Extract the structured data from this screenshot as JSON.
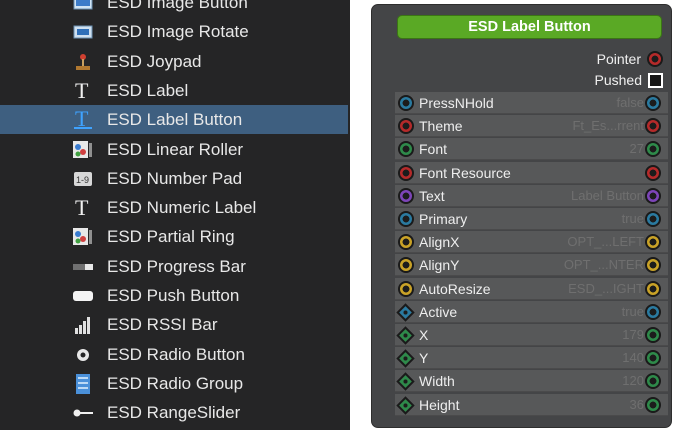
{
  "palette": {
    "items": [
      {
        "label": "ESD Image Button",
        "icon": "image-button-icon"
      },
      {
        "label": "ESD Image Rotate",
        "icon": "image-rotate-icon"
      },
      {
        "label": "ESD Joypad",
        "icon": "joystick-icon"
      },
      {
        "label": "ESD Label",
        "icon": "text-t-icon"
      },
      {
        "label": "ESD Label Button",
        "icon": "text-t-blue-icon"
      },
      {
        "label": "ESD Linear Roller",
        "icon": "linear-roller-icon"
      },
      {
        "label": "ESD Number Pad",
        "icon": "number-pad-icon"
      },
      {
        "label": "ESD Numeric Label",
        "icon": "text-t-icon"
      },
      {
        "label": "ESD Partial Ring",
        "icon": "partial-ring-icon"
      },
      {
        "label": "ESD Progress Bar",
        "icon": "progress-bar-icon"
      },
      {
        "label": "ESD Push Button",
        "icon": "push-button-icon"
      },
      {
        "label": "ESD RSSI Bar",
        "icon": "rssi-bars-icon"
      },
      {
        "label": "ESD Radio Button",
        "icon": "radio-button-icon"
      },
      {
        "label": "ESD Radio Group",
        "icon": "radio-group-icon"
      },
      {
        "label": "ESD RangeSlider",
        "icon": "range-slider-icon"
      }
    ],
    "selected_index": 4
  },
  "node": {
    "title": "ESD Label Button",
    "outputs": [
      {
        "label": "Pointer",
        "port_color": "#b52a2a",
        "shape": "circle"
      },
      {
        "label": "Pushed",
        "port_color": "#ffffff",
        "shape": "square"
      }
    ],
    "properties": [
      {
        "name": "PressNHold",
        "value": "false",
        "in_color": "#2a7aa0",
        "out_color": "#2a7aa0",
        "in_shape": "circle"
      },
      {
        "name": "Theme",
        "value": "Ft_Es...rrent",
        "in_color": "#b52a2a",
        "out_color": "#b52a2a",
        "in_shape": "circle"
      },
      {
        "name": "Font",
        "value": "27",
        "in_color": "#2e8a4a",
        "out_color": "#2e8a4a",
        "in_shape": "circle"
      },
      {
        "name": "Font Resource",
        "value": "",
        "in_color": "#b52a2a",
        "out_color": "#b52a2a",
        "in_shape": "circle"
      },
      {
        "name": "Text",
        "value": "Label Button",
        "in_color": "#7d45b8",
        "out_color": "#7d45b8",
        "in_shape": "circle"
      },
      {
        "name": "Primary",
        "value": "true",
        "in_color": "#2a7aa0",
        "out_color": "#2a7aa0",
        "in_shape": "circle"
      },
      {
        "name": "AlignX",
        "value": "OPT_...LEFT",
        "in_color": "#c9a227",
        "out_color": "#c9a227",
        "in_shape": "circle"
      },
      {
        "name": "AlignY",
        "value": "OPT_...NTER",
        "in_color": "#c9a227",
        "out_color": "#c9a227",
        "in_shape": "circle"
      },
      {
        "name": "AutoResize",
        "value": "ESD_...IGHT",
        "in_color": "#c9a227",
        "out_color": "#c9a227",
        "in_shape": "circle"
      },
      {
        "name": "Active",
        "value": "true",
        "in_color": "#2a7aa0",
        "out_color": "#2a7aa0",
        "in_shape": "diamond"
      },
      {
        "name": "X",
        "value": "179",
        "in_color": "#2e8a4a",
        "out_color": "#2e8a4a",
        "in_shape": "diamond"
      },
      {
        "name": "Y",
        "value": "140",
        "in_color": "#2e8a4a",
        "out_color": "#2e8a4a",
        "in_shape": "diamond"
      },
      {
        "name": "Width",
        "value": "120",
        "in_color": "#2e8a4a",
        "out_color": "#2e8a4a",
        "in_shape": "diamond"
      },
      {
        "name": "Height",
        "value": "36",
        "in_color": "#2e8a4a",
        "out_color": "#2e8a4a",
        "in_shape": "diamond"
      }
    ]
  }
}
